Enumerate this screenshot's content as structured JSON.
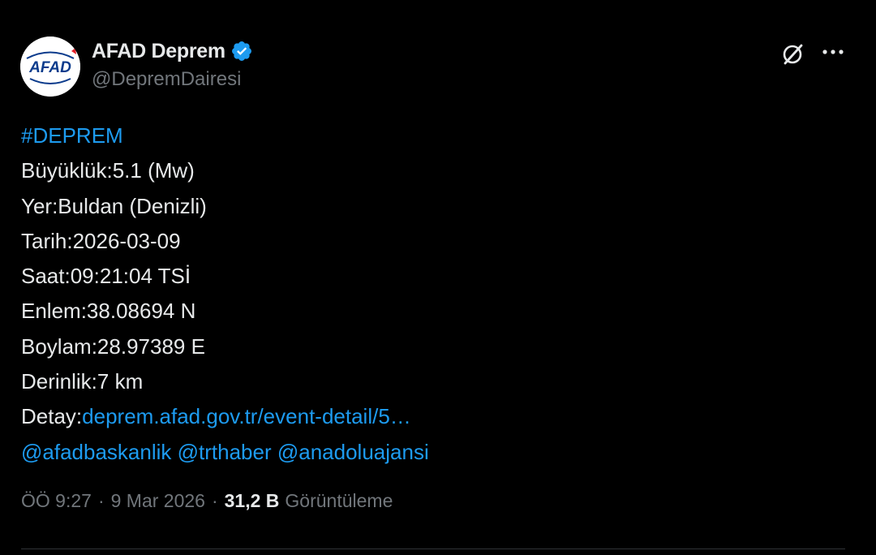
{
  "author": {
    "avatar_text": "AFAD",
    "display_name": "AFAD Deprem",
    "verified_icon": "verified-badge-icon",
    "handle": "@DepremDairesi"
  },
  "actions": {
    "grok_icon": "grok-icon",
    "more_icon": "more-options-icon"
  },
  "tweet": {
    "hashtag": "#DEPREM",
    "magnitude": "Büyüklük:5.1 (Mw)",
    "location": "Yer:Buldan (Denizli)",
    "date": "Tarih:2026-03-09",
    "time": "Saat:09:21:04 TSİ",
    "latitude": "Enlem:38.08694 N",
    "longitude": "Boylam:28.97389 E",
    "depth": "Derinlik:7 km",
    "detail_label": "Detay:",
    "detail_link": "deprem.afad.gov.tr/event-detail/5…",
    "mentions": [
      "@afadbaskanlik",
      "@trthaber",
      "@anadoluajansi"
    ]
  },
  "meta": {
    "time": "ÖÖ 9:27",
    "separator": "·",
    "date": "9 Mar 2026",
    "views_count": "31,2 B",
    "views_label": "Görüntüleme"
  },
  "colors": {
    "background": "#000000",
    "text": "#e7e9ea",
    "secondary": "#71767b",
    "link": "#1d9bf0",
    "brand_blue": "#0b3b8c",
    "brand_red": "#e3212b"
  }
}
